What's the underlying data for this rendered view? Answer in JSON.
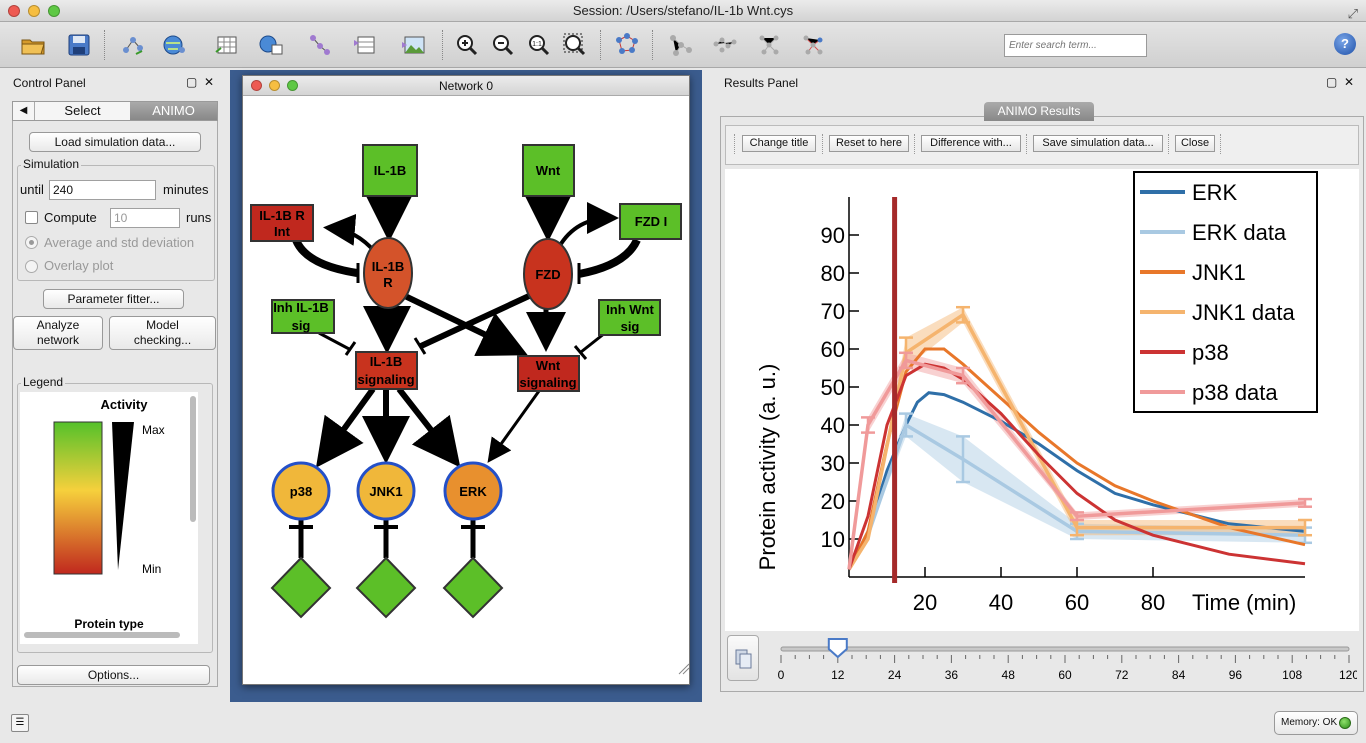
{
  "window": {
    "title": "Session:  /Users/stefano/IL-1b Wnt.cys"
  },
  "toolbar": {
    "search_placeholder": "Enter search term...",
    "help_label": "?",
    "icons": [
      "open-folder-icon",
      "save-icon",
      "import-network-icon",
      "import-network-url-icon",
      "import-table-icon",
      "import-network-web-icon",
      "import-ontology-icon",
      "import-attributes-icon",
      "import-image-icon",
      "zoom-in-icon",
      "zoom-out-icon",
      "zoom-fit-icon",
      "zoom-selected-icon",
      "network-layout-icon",
      "hide-nodes-icon",
      "show-nodes-icon",
      "first-neighbors-icon",
      "select-edges-icon"
    ]
  },
  "control_panel": {
    "title": "Control Panel",
    "tabs": {
      "select": "Select",
      "animo": "ANIMO"
    },
    "load_button": "Load simulation data...",
    "simulation": {
      "title": "Simulation",
      "until_label": "until",
      "until_value": "240",
      "minutes_label": "minutes",
      "compute_label": "Compute",
      "compute_value": "10",
      "runs_label": "runs",
      "avg_label": "Average and std deviation",
      "overlay_label": "Overlay plot"
    },
    "parameter_button": "Parameter fitter...",
    "analyze_button": {
      "line1": "Analyze",
      "line2": "network"
    },
    "model_button": {
      "line1": "Model",
      "line2": "checking..."
    },
    "legend": {
      "title": "Legend",
      "activity_label": "Activity",
      "max_label": "Max",
      "min_label": "Min",
      "cut_label": "Protein type"
    },
    "options_button": "Options..."
  },
  "network": {
    "title": "Network 0",
    "nodes": {
      "il1b": "IL-1B",
      "wnt": "Wnt",
      "il1br_int_1": "IL-1B R",
      "il1br_int_2": "Int",
      "fzd_i": "FZD I",
      "il1br_1": "IL-1B",
      "il1br_2": "R",
      "fzd": "FZD",
      "inh_il1b_1": "Inh IL-1B",
      "inh_il1b_2": "sig",
      "inh_wnt_1": "Inh Wnt",
      "inh_wnt_2": "sig",
      "il1b_sig_1": "IL-1B",
      "il1b_sig_2": "signaling",
      "wnt_sig_1": "Wnt",
      "wnt_sig_2": "signaling",
      "p38": "p38",
      "jnk1": "JNK1",
      "erk": "ERK"
    }
  },
  "results_panel": {
    "title": "Results Panel",
    "tab": "ANIMO Results",
    "buttons": [
      "Change title",
      "Reset to here",
      "Difference with...",
      "Save simulation data...",
      "Close"
    ],
    "slider": {
      "value": 12,
      "ticks": [
        "0",
        "12",
        "24",
        "36",
        "48",
        "60",
        "72",
        "84",
        "96",
        "108",
        "120"
      ]
    }
  },
  "chart_data": {
    "type": "line",
    "title": "",
    "xlabel": "Time (min)",
    "ylabel": "Protein activity (a. u.)",
    "xlim": [
      0,
      120
    ],
    "ylim": [
      0,
      100
    ],
    "xticks": [
      20,
      40,
      60,
      80
    ],
    "yticks": [
      10,
      20,
      30,
      40,
      50,
      60,
      70,
      80,
      90
    ],
    "vline": {
      "x": 12,
      "color": "#a52a2a"
    },
    "legend_position": "top-right",
    "series": [
      {
        "name": "ERK",
        "color": "#2f6fa8",
        "style": "line",
        "points": [
          [
            0,
            2
          ],
          [
            5,
            12
          ],
          [
            10,
            28
          ],
          [
            15,
            40
          ],
          [
            18,
            46
          ],
          [
            21,
            48.5
          ],
          [
            25,
            48
          ],
          [
            30,
            46
          ],
          [
            40,
            41
          ],
          [
            50,
            35
          ],
          [
            60,
            28
          ],
          [
            70,
            22
          ],
          [
            80,
            19
          ],
          [
            100,
            14
          ],
          [
            120,
            12
          ]
        ]
      },
      {
        "name": "ERK data",
        "color": "#a9c9e2",
        "style": "data",
        "points": [
          [
            0,
            2
          ],
          [
            5,
            11
          ],
          [
            15,
            40
          ],
          [
            30,
            31
          ],
          [
            60,
            12
          ],
          [
            120,
            11
          ]
        ],
        "err": [
          0,
          0,
          3,
          6,
          2,
          2
        ]
      },
      {
        "name": "JNK1",
        "color": "#e8772a",
        "style": "line",
        "points": [
          [
            0,
            2
          ],
          [
            5,
            12
          ],
          [
            10,
            35
          ],
          [
            15,
            54
          ],
          [
            20,
            60
          ],
          [
            25,
            60
          ],
          [
            30,
            56
          ],
          [
            40,
            47
          ],
          [
            50,
            38
          ],
          [
            60,
            30
          ],
          [
            70,
            24
          ],
          [
            80,
            20
          ],
          [
            100,
            13
          ],
          [
            120,
            8.5
          ]
        ]
      },
      {
        "name": "JNK1 data",
        "color": "#f5b46e",
        "style": "data",
        "points": [
          [
            0,
            2
          ],
          [
            5,
            10
          ],
          [
            15,
            59
          ],
          [
            30,
            69
          ],
          [
            60,
            13
          ],
          [
            120,
            13
          ]
        ],
        "err": [
          0,
          0,
          4,
          2,
          2,
          2
        ]
      },
      {
        "name": "p38",
        "color": "#cc3333",
        "style": "line",
        "points": [
          [
            0,
            2
          ],
          [
            5,
            16
          ],
          [
            10,
            40
          ],
          [
            15,
            53
          ],
          [
            20,
            56
          ],
          [
            25,
            55
          ],
          [
            30,
            52
          ],
          [
            40,
            43
          ],
          [
            50,
            32
          ],
          [
            60,
            22
          ],
          [
            70,
            15
          ],
          [
            80,
            11
          ],
          [
            100,
            6
          ],
          [
            120,
            3.5
          ]
        ]
      },
      {
        "name": "p38 data",
        "color": "#f09a9a",
        "style": "data",
        "points": [
          [
            0,
            2
          ],
          [
            5,
            40
          ],
          [
            15,
            57
          ],
          [
            30,
            53
          ],
          [
            60,
            16
          ],
          [
            120,
            19.5
          ]
        ],
        "err": [
          0,
          2,
          2,
          2,
          1,
          1
        ]
      }
    ]
  },
  "status": {
    "memory_label": "Memory: OK"
  }
}
